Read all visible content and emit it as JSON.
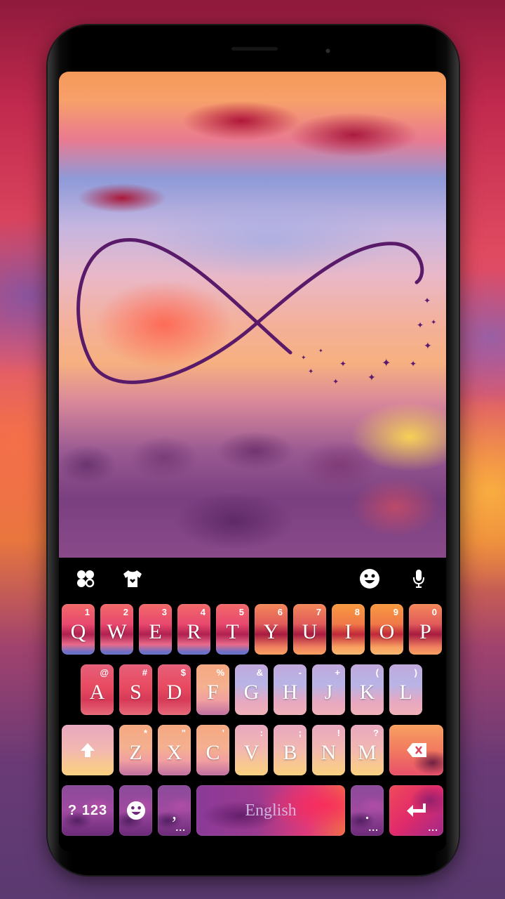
{
  "keyboard": {
    "toolbar": {
      "left_icons": [
        "apps-icon",
        "theme-shirt-icon"
      ],
      "right_icons": [
        "emoji-icon",
        "microphone-icon"
      ]
    },
    "rows": [
      [
        {
          "label": "Q",
          "hint": "1"
        },
        {
          "label": "W",
          "hint": "2"
        },
        {
          "label": "E",
          "hint": "3"
        },
        {
          "label": "R",
          "hint": "4"
        },
        {
          "label": "T",
          "hint": "5"
        },
        {
          "label": "Y",
          "hint": "6"
        },
        {
          "label": "U",
          "hint": "7"
        },
        {
          "label": "I",
          "hint": "8"
        },
        {
          "label": "O",
          "hint": "9"
        },
        {
          "label": "P",
          "hint": "0"
        }
      ],
      [
        {
          "label": "A",
          "hint": "@"
        },
        {
          "label": "S",
          "hint": "#"
        },
        {
          "label": "D",
          "hint": "$"
        },
        {
          "label": "F",
          "hint": "%"
        },
        {
          "label": "G",
          "hint": "&"
        },
        {
          "label": "H",
          "hint": "-"
        },
        {
          "label": "J",
          "hint": "+"
        },
        {
          "label": "K",
          "hint": "("
        },
        {
          "label": "L",
          "hint": ")"
        }
      ],
      [
        {
          "label": "Z",
          "hint": "*"
        },
        {
          "label": "X",
          "hint": "\""
        },
        {
          "label": "C",
          "hint": "'"
        },
        {
          "label": "V",
          "hint": ":"
        },
        {
          "label": "B",
          "hint": ";"
        },
        {
          "label": "N",
          "hint": "!"
        },
        {
          "label": "M",
          "hint": "?"
        }
      ]
    ],
    "bottom": {
      "symbols_label": "? 123",
      "comma_label": ",",
      "space_label": "English",
      "period_label": ".",
      "more_dots": "..."
    },
    "special_icons": {
      "shift": "shift-arrow-icon",
      "backspace": "backspace-icon",
      "enter": "enter-return-icon",
      "emoji": "emoji-icon"
    }
  }
}
